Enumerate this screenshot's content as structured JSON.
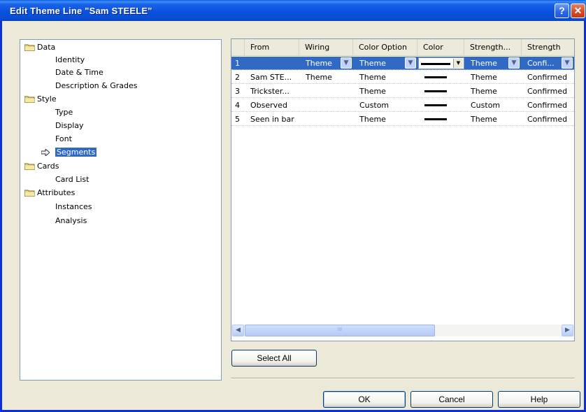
{
  "window": {
    "title": "Edit Theme Line \"Sam STEELE\"",
    "help_glyph": "?",
    "close_glyph": "✕"
  },
  "tree": {
    "groups": [
      {
        "label": "Data",
        "children": [
          "Identity",
          "Date & Time",
          "Description & Grades"
        ]
      },
      {
        "label": "Style",
        "children": [
          "Type",
          "Display",
          "Font",
          "Segments"
        ]
      },
      {
        "label": "Cards",
        "children": [
          "Card List"
        ]
      },
      {
        "label": "Attributes",
        "children": [
          "Instances",
          "Analysis"
        ]
      }
    ],
    "selected": "Segments"
  },
  "grid": {
    "columns": [
      "From",
      "Wiring",
      "Color Option",
      "Color",
      "Strength...",
      "Strength"
    ],
    "rows": [
      {
        "num": "1",
        "from": "",
        "wiring": "Theme",
        "color_option": "Theme",
        "strength_option": "Theme",
        "strength": "Confi..."
      },
      {
        "num": "2",
        "from": "Sam STE...",
        "wiring": "Theme",
        "color_option": "Theme",
        "strength_option": "Theme",
        "strength": "Confirmed"
      },
      {
        "num": "3",
        "from": "Trickster...",
        "wiring": "",
        "color_option": "Theme",
        "strength_option": "Theme",
        "strength": "Confirmed"
      },
      {
        "num": "4",
        "from": "Observed",
        "wiring": "",
        "color_option": "Custom",
        "strength_option": "Custom",
        "strength": "Confirmed"
      },
      {
        "num": "5",
        "from": "Seen in bar",
        "wiring": "",
        "color_option": "Theme",
        "strength_option": "Theme",
        "strength": "Confirmed"
      }
    ],
    "scroll_thumb_glyph": "III"
  },
  "buttons": {
    "select_all": "Select All",
    "ok": "OK",
    "cancel": "Cancel",
    "help": "Help"
  },
  "colors": {
    "selection": "#316ac5",
    "title_bar": "#0a5ce8",
    "dialog_bg": "#ece9d8"
  }
}
